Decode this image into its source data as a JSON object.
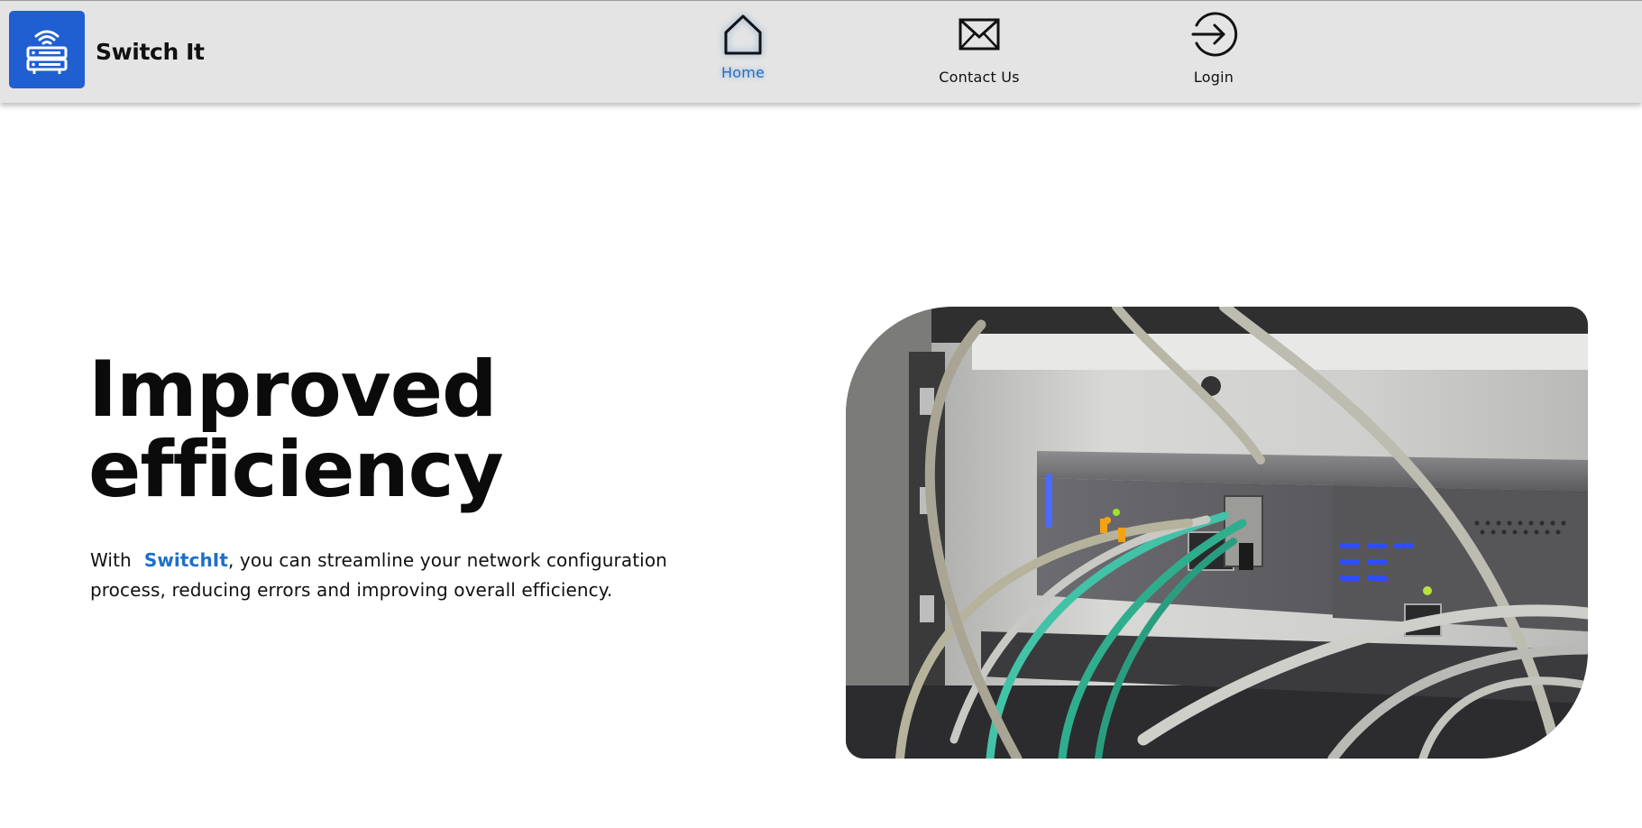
{
  "header": {
    "brand": "Switch It",
    "nav": [
      {
        "label": "Home",
        "icon": "home-icon",
        "active": true
      },
      {
        "label": "Contact Us",
        "icon": "mail-icon",
        "active": false
      },
      {
        "label": "Login",
        "icon": "login-icon",
        "active": false
      }
    ]
  },
  "hero": {
    "title_line1": "Improved",
    "title_line2": "efficiency",
    "text_prefix": "With",
    "text_brand": "SwitchIt",
    "text_rest": ", you can streamline your network configuration",
    "text_line2": "process, reducing errors and improving overall efficiency."
  },
  "colors": {
    "header_bg": "#e4e4e4",
    "logo_bg": "#1f5fd2",
    "accent": "#1f6fc8",
    "text": "#111111"
  }
}
